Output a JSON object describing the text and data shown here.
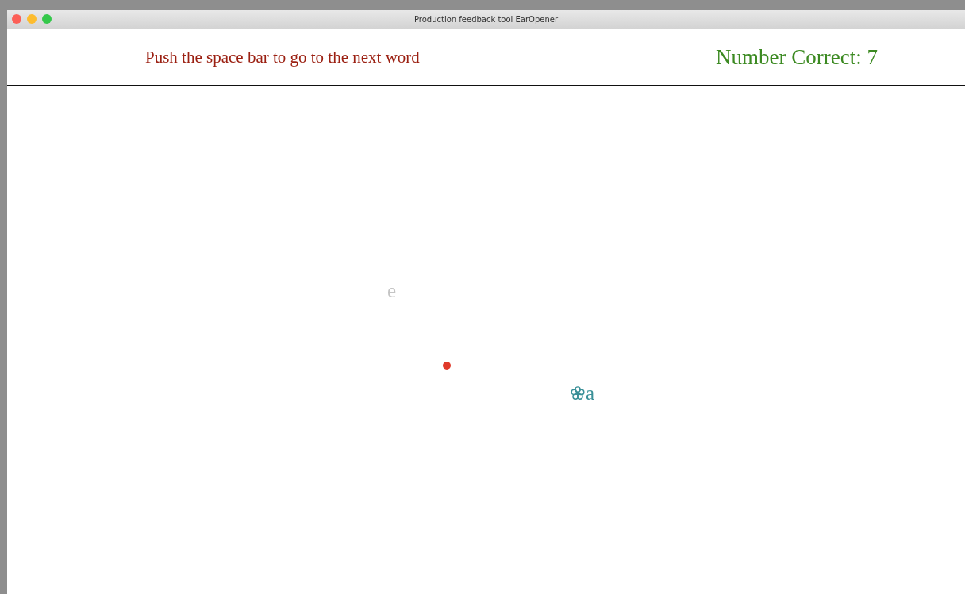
{
  "window": {
    "title": "Production feedback tool EarOpener"
  },
  "header": {
    "instruction": "Push the space bar to go to the next word",
    "score": "Number Correct: 7"
  },
  "vowels": [
    {
      "label": "e",
      "kind": "other"
    },
    {
      "label": "a",
      "kind": "target"
    }
  ]
}
